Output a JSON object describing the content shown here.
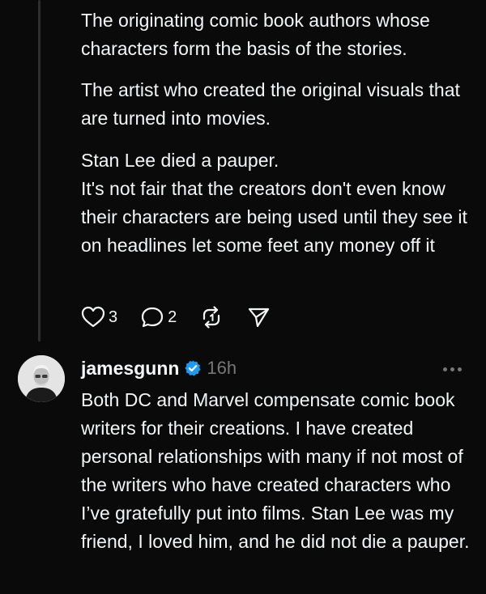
{
  "parent_post": {
    "paragraphs": [
      "The originating comic book authors whose characters form the basis of the stories.",
      "The artist who created the original visuals that are turned into movies.",
      "Stan Lee died a pauper.\nIt's not fair that the creators don't even know their characters are being used until they see it on headlines let some feet any money off it"
    ],
    "likes": "3",
    "comments": "2"
  },
  "reply": {
    "username": "jamesgunn",
    "verified": true,
    "time": "16h",
    "text": "Both DC and Marvel compensate comic book writers for their creations. I have created personal relationships with many if not most of the writers who have created characters who I’ve gratefully put into films. Stan Lee was my friend, I loved him, and he did not die a pauper."
  },
  "icons": {
    "like": "heart-icon",
    "comment": "comment-icon",
    "repost": "repost-icon",
    "share": "send-icon",
    "verified": "verified-badge-icon",
    "more": "more-options-icon"
  },
  "colors": {
    "background": "#0a0a0a",
    "text": "#f3f5f7",
    "muted": "#777777",
    "verified": "#1d9bf0"
  }
}
